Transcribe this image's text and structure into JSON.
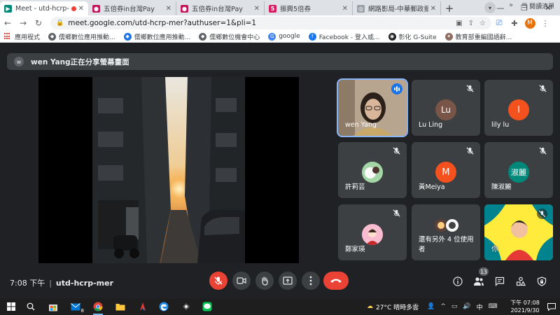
{
  "browser": {
    "tabs": [
      {
        "title": "Meet - utd-hcrp-mer",
        "active": true,
        "recording": true
      },
      {
        "title": "五倍券in台灣Pay",
        "active": false
      },
      {
        "title": "五倍券in台灣Pay",
        "active": false
      },
      {
        "title": "振興5倍券",
        "active": false
      },
      {
        "title": "網路影局-中華郵政振興五",
        "active": false
      }
    ],
    "new_tab": "+",
    "url": "meet.google.com/utd-hcrp-mer?authuser=1&pli=1",
    "profile_initial": "M",
    "bookmarks": [
      {
        "label": "應用程式",
        "color": "#ea4335"
      },
      {
        "label": "儒鄉數位應用推動...",
        "color": "#5f6368"
      },
      {
        "label": "儒鄉數位應用推動...",
        "color": "#1a73e8"
      },
      {
        "label": "儒鄉數位機會中心",
        "color": "#5f6368"
      },
      {
        "label": "google",
        "color": "#4285f4"
      },
      {
        "label": "Facebook - 登入或...",
        "color": "#1877f2"
      },
      {
        "label": "彰化 G-Suite",
        "color": "#202124"
      },
      {
        "label": "教育部重編國語辭...",
        "color": "#8d6e63"
      }
    ],
    "bookmarks_more": "»",
    "reading_list": "閱讀清單"
  },
  "meet": {
    "presenter_initial": "w",
    "presenting_text": "wen Yang正在分享螢幕畫面",
    "tiles": [
      {
        "name": "wen Yang",
        "kind": "video",
        "speaking": true
      },
      {
        "name": "Lu Ling",
        "kind": "initial",
        "initial": "Lu",
        "color": "#795548"
      },
      {
        "name": "lily lu",
        "kind": "initial",
        "initial": "l",
        "color": "#f4511e"
      },
      {
        "name": "許莉芸",
        "kind": "photo",
        "color": "#7cb342"
      },
      {
        "name": "黃Meiya",
        "kind": "initial",
        "initial": "M",
        "color": "#f4511e"
      },
      {
        "name": "陳淑麗",
        "kind": "initial",
        "initial": "淑麗",
        "color": "#00897b"
      },
      {
        "name": "鄭家瑛",
        "kind": "photo",
        "color": "#e57373"
      },
      {
        "name": "還有另外 4 位使用者",
        "kind": "others"
      },
      {
        "name": "你",
        "kind": "self"
      }
    ],
    "time": "7:08 下午",
    "separator": "|",
    "meeting_code": "utd-hcrp-mer",
    "participant_count": "13",
    "colors": {
      "danger": "#ea4335",
      "control_bg": "#3c4043",
      "bg": "#202124",
      "accent": "#1a73e8"
    }
  },
  "taskbar": {
    "weather": "27°C  晴時多雲",
    "ime": "中",
    "time": "下午 07:08",
    "date": "2021/9/30",
    "notification_count": "8"
  }
}
